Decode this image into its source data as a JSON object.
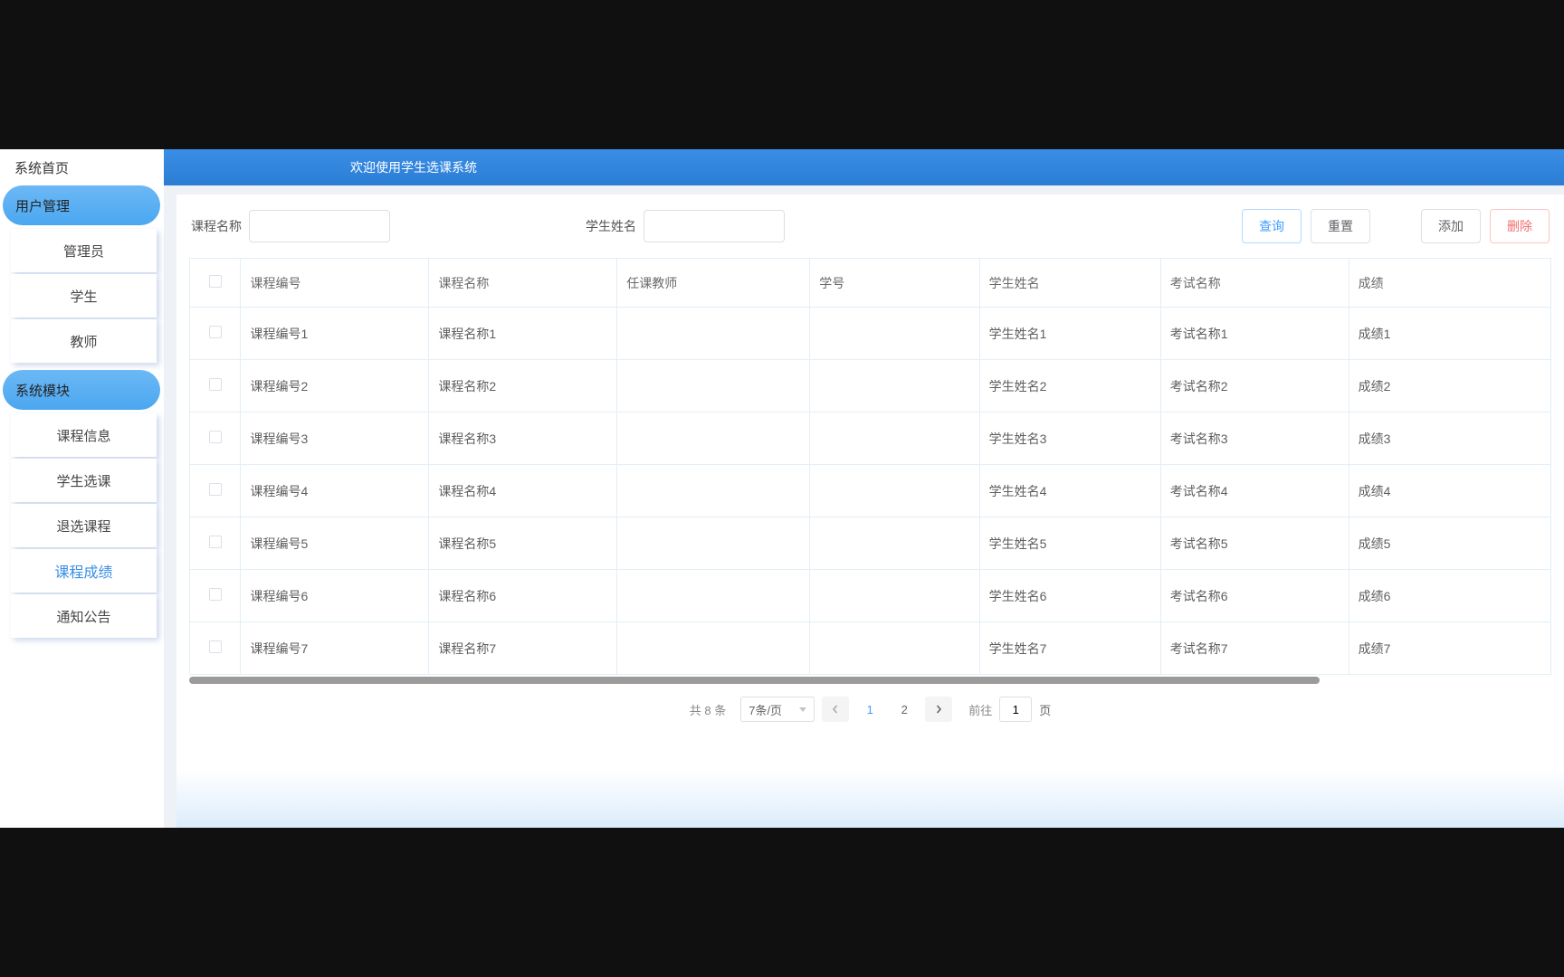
{
  "sidebar": {
    "home": "系统首页",
    "section1": {
      "title": "用户管理",
      "items": [
        "管理员",
        "学生",
        "教师"
      ]
    },
    "section2": {
      "title": "系统模块",
      "items": [
        "课程信息",
        "学生选课",
        "退选课程",
        "课程成绩",
        "通知公告"
      ],
      "activeIndex": 3
    }
  },
  "banner": {
    "title": "欢迎使用学生选课系统"
  },
  "search": {
    "label1": "课程名称",
    "label2": "学生姓名",
    "btnQuery": "查询",
    "btnReset": "重置",
    "btnAdd": "添加",
    "btnDelete": "删除"
  },
  "table": {
    "headers": [
      "课程编号",
      "课程名称",
      "任课教师",
      "学号",
      "学生姓名",
      "考试名称",
      "成绩"
    ],
    "rows": [
      {
        "c1": "课程编号1",
        "c2": "课程名称1",
        "c3": "",
        "c4": "",
        "c5": "学生姓名1",
        "c6": "考试名称1",
        "c7": "成绩1"
      },
      {
        "c1": "课程编号2",
        "c2": "课程名称2",
        "c3": "",
        "c4": "",
        "c5": "学生姓名2",
        "c6": "考试名称2",
        "c7": "成绩2"
      },
      {
        "c1": "课程编号3",
        "c2": "课程名称3",
        "c3": "",
        "c4": "",
        "c5": "学生姓名3",
        "c6": "考试名称3",
        "c7": "成绩3"
      },
      {
        "c1": "课程编号4",
        "c2": "课程名称4",
        "c3": "",
        "c4": "",
        "c5": "学生姓名4",
        "c6": "考试名称4",
        "c7": "成绩4"
      },
      {
        "c1": "课程编号5",
        "c2": "课程名称5",
        "c3": "",
        "c4": "",
        "c5": "学生姓名5",
        "c6": "考试名称5",
        "c7": "成绩5"
      },
      {
        "c1": "课程编号6",
        "c2": "课程名称6",
        "c3": "",
        "c4": "",
        "c5": "学生姓名6",
        "c6": "考试名称6",
        "c7": "成绩6"
      },
      {
        "c1": "课程编号7",
        "c2": "课程名称7",
        "c3": "",
        "c4": "",
        "c5": "学生姓名7",
        "c6": "考试名称7",
        "c7": "成绩7"
      }
    ]
  },
  "pagination": {
    "total": "共 8 条",
    "pageSize": "7条/页",
    "pages": [
      "1",
      "2"
    ],
    "currentPage": "1",
    "jumpPrefix": "前往",
    "jumpValue": "1",
    "jumpSuffix": "页"
  }
}
